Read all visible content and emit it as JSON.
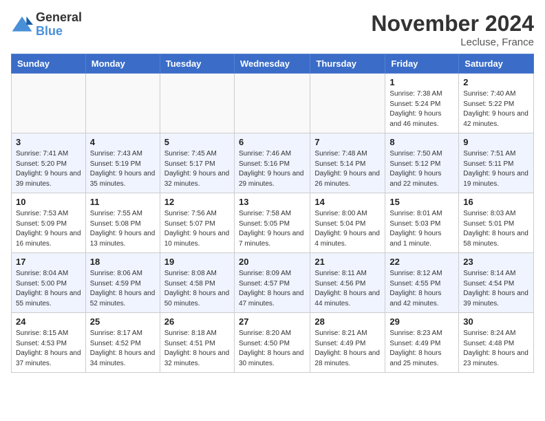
{
  "logo": {
    "general": "General",
    "blue": "Blue"
  },
  "title": "November 2024",
  "location": "Lecluse, France",
  "days_of_week": [
    "Sunday",
    "Monday",
    "Tuesday",
    "Wednesday",
    "Thursday",
    "Friday",
    "Saturday"
  ],
  "weeks": [
    [
      {
        "day": "",
        "sunrise": "",
        "sunset": "",
        "daylight": ""
      },
      {
        "day": "",
        "sunrise": "",
        "sunset": "",
        "daylight": ""
      },
      {
        "day": "",
        "sunrise": "",
        "sunset": "",
        "daylight": ""
      },
      {
        "day": "",
        "sunrise": "",
        "sunset": "",
        "daylight": ""
      },
      {
        "day": "",
        "sunrise": "",
        "sunset": "",
        "daylight": ""
      },
      {
        "day": "1",
        "sunrise": "Sunrise: 7:38 AM",
        "sunset": "Sunset: 5:24 PM",
        "daylight": "Daylight: 9 hours and 46 minutes."
      },
      {
        "day": "2",
        "sunrise": "Sunrise: 7:40 AM",
        "sunset": "Sunset: 5:22 PM",
        "daylight": "Daylight: 9 hours and 42 minutes."
      }
    ],
    [
      {
        "day": "3",
        "sunrise": "Sunrise: 7:41 AM",
        "sunset": "Sunset: 5:20 PM",
        "daylight": "Daylight: 9 hours and 39 minutes."
      },
      {
        "day": "4",
        "sunrise": "Sunrise: 7:43 AM",
        "sunset": "Sunset: 5:19 PM",
        "daylight": "Daylight: 9 hours and 35 minutes."
      },
      {
        "day": "5",
        "sunrise": "Sunrise: 7:45 AM",
        "sunset": "Sunset: 5:17 PM",
        "daylight": "Daylight: 9 hours and 32 minutes."
      },
      {
        "day": "6",
        "sunrise": "Sunrise: 7:46 AM",
        "sunset": "Sunset: 5:16 PM",
        "daylight": "Daylight: 9 hours and 29 minutes."
      },
      {
        "day": "7",
        "sunrise": "Sunrise: 7:48 AM",
        "sunset": "Sunset: 5:14 PM",
        "daylight": "Daylight: 9 hours and 26 minutes."
      },
      {
        "day": "8",
        "sunrise": "Sunrise: 7:50 AM",
        "sunset": "Sunset: 5:12 PM",
        "daylight": "Daylight: 9 hours and 22 minutes."
      },
      {
        "day": "9",
        "sunrise": "Sunrise: 7:51 AM",
        "sunset": "Sunset: 5:11 PM",
        "daylight": "Daylight: 9 hours and 19 minutes."
      }
    ],
    [
      {
        "day": "10",
        "sunrise": "Sunrise: 7:53 AM",
        "sunset": "Sunset: 5:09 PM",
        "daylight": "Daylight: 9 hours and 16 minutes."
      },
      {
        "day": "11",
        "sunrise": "Sunrise: 7:55 AM",
        "sunset": "Sunset: 5:08 PM",
        "daylight": "Daylight: 9 hours and 13 minutes."
      },
      {
        "day": "12",
        "sunrise": "Sunrise: 7:56 AM",
        "sunset": "Sunset: 5:07 PM",
        "daylight": "Daylight: 9 hours and 10 minutes."
      },
      {
        "day": "13",
        "sunrise": "Sunrise: 7:58 AM",
        "sunset": "Sunset: 5:05 PM",
        "daylight": "Daylight: 9 hours and 7 minutes."
      },
      {
        "day": "14",
        "sunrise": "Sunrise: 8:00 AM",
        "sunset": "Sunset: 5:04 PM",
        "daylight": "Daylight: 9 hours and 4 minutes."
      },
      {
        "day": "15",
        "sunrise": "Sunrise: 8:01 AM",
        "sunset": "Sunset: 5:03 PM",
        "daylight": "Daylight: 9 hours and 1 minute."
      },
      {
        "day": "16",
        "sunrise": "Sunrise: 8:03 AM",
        "sunset": "Sunset: 5:01 PM",
        "daylight": "Daylight: 8 hours and 58 minutes."
      }
    ],
    [
      {
        "day": "17",
        "sunrise": "Sunrise: 8:04 AM",
        "sunset": "Sunset: 5:00 PM",
        "daylight": "Daylight: 8 hours and 55 minutes."
      },
      {
        "day": "18",
        "sunrise": "Sunrise: 8:06 AM",
        "sunset": "Sunset: 4:59 PM",
        "daylight": "Daylight: 8 hours and 52 minutes."
      },
      {
        "day": "19",
        "sunrise": "Sunrise: 8:08 AM",
        "sunset": "Sunset: 4:58 PM",
        "daylight": "Daylight: 8 hours and 50 minutes."
      },
      {
        "day": "20",
        "sunrise": "Sunrise: 8:09 AM",
        "sunset": "Sunset: 4:57 PM",
        "daylight": "Daylight: 8 hours and 47 minutes."
      },
      {
        "day": "21",
        "sunrise": "Sunrise: 8:11 AM",
        "sunset": "Sunset: 4:56 PM",
        "daylight": "Daylight: 8 hours and 44 minutes."
      },
      {
        "day": "22",
        "sunrise": "Sunrise: 8:12 AM",
        "sunset": "Sunset: 4:55 PM",
        "daylight": "Daylight: 8 hours and 42 minutes."
      },
      {
        "day": "23",
        "sunrise": "Sunrise: 8:14 AM",
        "sunset": "Sunset: 4:54 PM",
        "daylight": "Daylight: 8 hours and 39 minutes."
      }
    ],
    [
      {
        "day": "24",
        "sunrise": "Sunrise: 8:15 AM",
        "sunset": "Sunset: 4:53 PM",
        "daylight": "Daylight: 8 hours and 37 minutes."
      },
      {
        "day": "25",
        "sunrise": "Sunrise: 8:17 AM",
        "sunset": "Sunset: 4:52 PM",
        "daylight": "Daylight: 8 hours and 34 minutes."
      },
      {
        "day": "26",
        "sunrise": "Sunrise: 8:18 AM",
        "sunset": "Sunset: 4:51 PM",
        "daylight": "Daylight: 8 hours and 32 minutes."
      },
      {
        "day": "27",
        "sunrise": "Sunrise: 8:20 AM",
        "sunset": "Sunset: 4:50 PM",
        "daylight": "Daylight: 8 hours and 30 minutes."
      },
      {
        "day": "28",
        "sunrise": "Sunrise: 8:21 AM",
        "sunset": "Sunset: 4:49 PM",
        "daylight": "Daylight: 8 hours and 28 minutes."
      },
      {
        "day": "29",
        "sunrise": "Sunrise: 8:23 AM",
        "sunset": "Sunset: 4:49 PM",
        "daylight": "Daylight: 8 hours and 25 minutes."
      },
      {
        "day": "30",
        "sunrise": "Sunrise: 8:24 AM",
        "sunset": "Sunset: 4:48 PM",
        "daylight": "Daylight: 8 hours and 23 minutes."
      }
    ]
  ]
}
